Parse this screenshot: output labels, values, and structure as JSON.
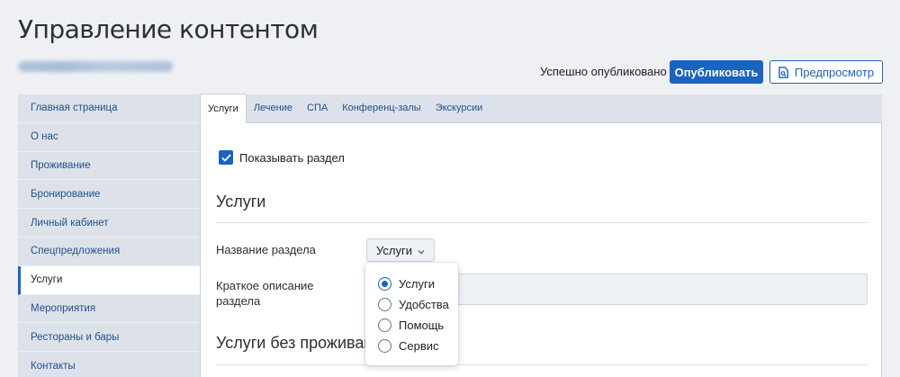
{
  "page_title": "Управление контентом",
  "header": {
    "publish_status": "Успешно опубликовано",
    "publish_label": "Опубликовать",
    "preview_label": "Предпросмотр",
    "preview_icon": "document-preview-icon"
  },
  "sidebar": {
    "items": [
      {
        "label": "Главная страница",
        "active": false
      },
      {
        "label": "О нас",
        "active": false
      },
      {
        "label": "Проживание",
        "active": false
      },
      {
        "label": "Бронирование",
        "active": false
      },
      {
        "label": "Личный кабинет",
        "active": false
      },
      {
        "label": "Спецпредложения",
        "active": false
      },
      {
        "label": "Услуги",
        "active": true
      },
      {
        "label": "Мероприятия",
        "active": false
      },
      {
        "label": "Рестораны и бары",
        "active": false
      },
      {
        "label": "Контакты",
        "active": false
      }
    ]
  },
  "tabs": [
    {
      "label": "Услуги",
      "active": true
    },
    {
      "label": "Лечение",
      "active": false
    },
    {
      "label": "СПА",
      "active": false
    },
    {
      "label": "Конференц-залы",
      "active": false
    },
    {
      "label": "Экскурсии",
      "active": false
    }
  ],
  "content": {
    "show_section_label": "Показывать раздел",
    "show_section_checked": true,
    "section1_heading": "Услуги",
    "section_name_label": "Название раздела",
    "section_name_value": "Услуги",
    "short_description_label_line1": "Краткое описание",
    "short_description_label_line2": "раздела",
    "section2_heading": "Услуги без проживан"
  },
  "dropdown": {
    "options": [
      {
        "label": "Услуги",
        "selected": true
      },
      {
        "label": "Удобства",
        "selected": false
      },
      {
        "label": "Помощь",
        "selected": false
      },
      {
        "label": "Сервис",
        "selected": false
      }
    ]
  },
  "colors": {
    "accent": "#1a63c0",
    "background": "#eef0f4",
    "sidebar_bg": "#dde2ea"
  }
}
